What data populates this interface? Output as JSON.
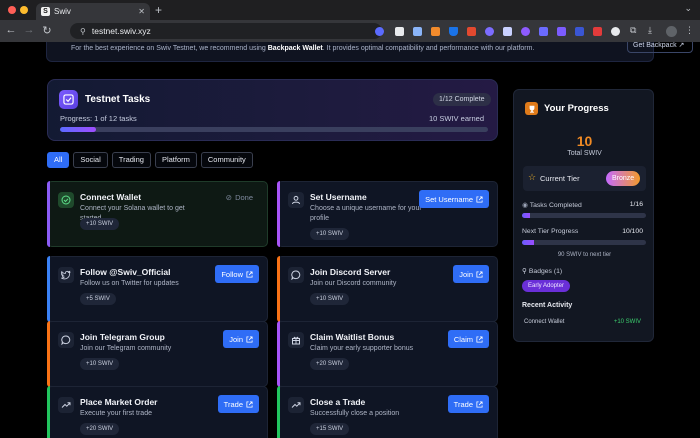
{
  "browser": {
    "tab_title": "Swiv",
    "tab_favicon": "S",
    "url": "testnet.swiv.xyz"
  },
  "banner": {
    "text_before": "For the best experience on Swiv Testnet, we recommend using ",
    "text_bold": "Backpack Wallet",
    "text_after": ". It provides optimal compatibility and performance with our platform.",
    "button": "Get Backpack"
  },
  "hero": {
    "title": "Testnet Tasks",
    "badge": "1/12 Complete",
    "progress_label": "Progress: 1 of 12 tasks",
    "earned": "10 SWIV earned",
    "progress_fraction": 0.083
  },
  "filters": [
    "All",
    "Social",
    "Trading",
    "Platform",
    "Community"
  ],
  "tasks": [
    {
      "title": "Connect Wallet",
      "desc": "Connect your Solana wallet to get started",
      "reward": "+10 SWIV",
      "action": "Done",
      "done": true,
      "icon": "check-circle-icon",
      "accent": "#8b5cf6"
    },
    {
      "title": "Set Username",
      "desc": "Choose a unique username for your profile",
      "reward": "+10 SWIV",
      "action": "Set Username",
      "done": false,
      "icon": "user-icon",
      "accent": "#a855f7"
    },
    {
      "title": "Follow @Swiv_Official",
      "desc": "Follow us on Twitter for updates",
      "reward": "+5 SWIV",
      "action": "Follow",
      "done": false,
      "icon": "twitter-icon",
      "accent": "#3b82f6"
    },
    {
      "title": "Join Discord Server",
      "desc": "Join our Discord community",
      "reward": "+10 SWIV",
      "action": "Join",
      "done": false,
      "icon": "chat-bubble-icon",
      "accent": "#f97316"
    },
    {
      "title": "Join Telegram Group",
      "desc": "Join our Telegram community",
      "reward": "+10 SWIV",
      "action": "Join",
      "done": false,
      "icon": "chat-bubble-icon",
      "accent": "#f97316"
    },
    {
      "title": "Claim Waitlist Bonus",
      "desc": "Claim your early supporter bonus",
      "reward": "+20 SWIV",
      "action": "Claim",
      "done": false,
      "icon": "gift-icon",
      "accent": "#a855f7"
    },
    {
      "title": "Place Market Order",
      "desc": "Execute your first trade",
      "reward": "+20 SWIV",
      "action": "Trade",
      "done": false,
      "icon": "trend-up-icon",
      "accent": "#22c55e"
    },
    {
      "title": "Close a Trade",
      "desc": "Successfully close a position",
      "reward": "+15 SWIV",
      "action": "Trade",
      "done": false,
      "icon": "trend-up-icon",
      "accent": "#22c55e"
    }
  ],
  "progress": {
    "title": "Your Progress",
    "total": "10",
    "total_label": "Total SWIV",
    "tier_label": "Current Tier",
    "tier": "Bronze",
    "tasks_label": "Tasks Completed",
    "tasks_value": "1/16",
    "tasks_fraction": 0.0625,
    "next_label": "Next Tier Progress",
    "next_value": "10/100",
    "next_fraction": 0.1,
    "next_note": "90 SWIV to next tier",
    "badges_label": "Badges (1)",
    "badge": "Early Adopter",
    "activity_title": "Recent Activity",
    "activity_name": "Connect Wallet",
    "activity_points": "+10 SWIV"
  },
  "colors": {
    "accent": "#2f6df6",
    "orange": "#f08a24",
    "success": "#3ccf6e"
  }
}
